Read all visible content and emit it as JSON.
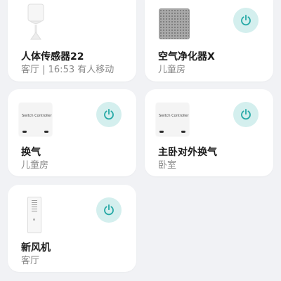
{
  "devices": [
    {
      "name": "人体传感器22",
      "subtitle": "客厅 | 16:53 有人移动",
      "image_icon": "motion-sensor-icon"
    },
    {
      "name": "空气净化器X",
      "subtitle": "儿童房",
      "image_icon": "air-purifier-icon"
    },
    {
      "name": "换气",
      "subtitle": "儿童房",
      "image_icon": "switch-controller-icon",
      "image_text": "Switch Controller"
    },
    {
      "name": "主卧对外换气",
      "subtitle": "卧室",
      "image_icon": "switch-controller-icon",
      "image_text": "Switch Controller"
    },
    {
      "name": "新风机",
      "subtitle": "客厅",
      "image_icon": "fresh-air-unit-icon"
    }
  ],
  "colors": {
    "background": "#f1f2f5",
    "card": "#ffffff",
    "power_accent": "#25a9a6",
    "power_bg": "#d4efee"
  },
  "icons": {
    "power": "power-icon"
  }
}
